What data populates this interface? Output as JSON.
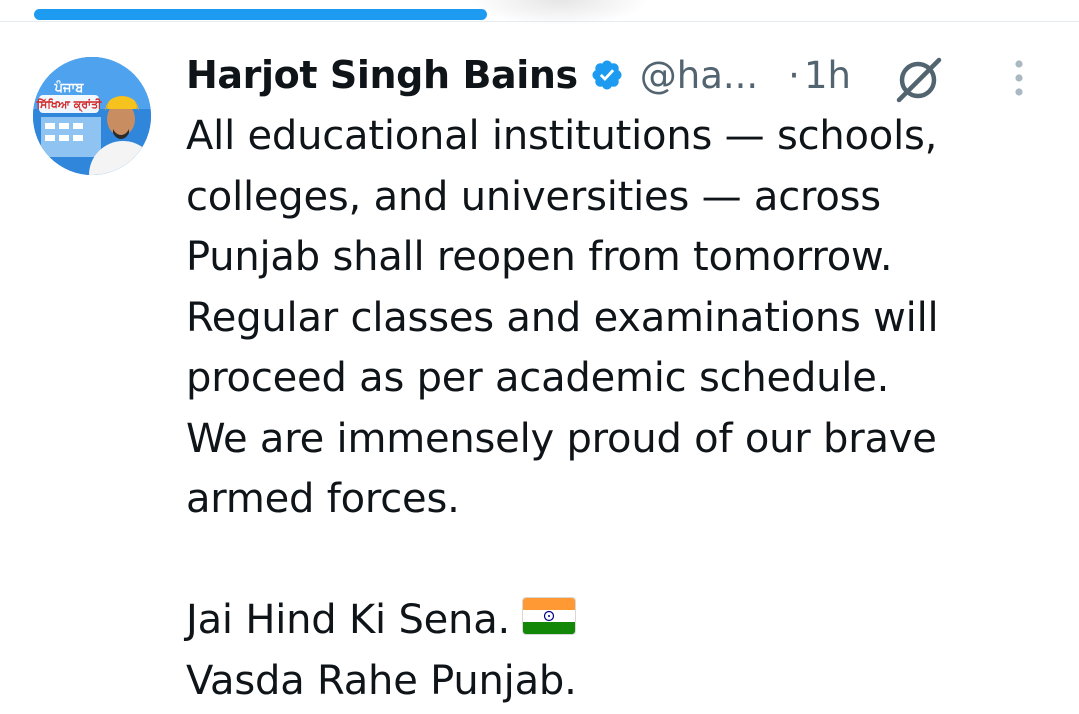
{
  "progress": {
    "fraction": 0.42
  },
  "tweet": {
    "author": {
      "name": "Harjot Singh Bains",
      "handle": "@ha...",
      "verified": true,
      "avatar_text_line1": "ਪੰਜਾਬ",
      "avatar_text_line2": "ਸਿੱਖਿਆ ਕ੍ਰਾਂਤੀ"
    },
    "separator": "·",
    "time": "1h",
    "lines": [
      "All educational institutions — schools,",
      "colleges, and universities — across",
      "Punjab shall reopen from tomorrow.",
      "Regular classes and examinations will",
      "proceed as per academic schedule.",
      "We are immensely proud of our brave",
      "armed forces.",
      "",
      "Jai Hind Ki Sena.",
      "Vasda Rahe Punjab."
    ]
  },
  "icons": {
    "verified": "verified-badge-icon",
    "grok": "grok-icon",
    "more": "more-vertical-icon",
    "flag": "india-flag-emoji"
  },
  "colors": {
    "accent": "#1d9bf0",
    "text": "#0f1419",
    "secondary_text": "#536471"
  }
}
